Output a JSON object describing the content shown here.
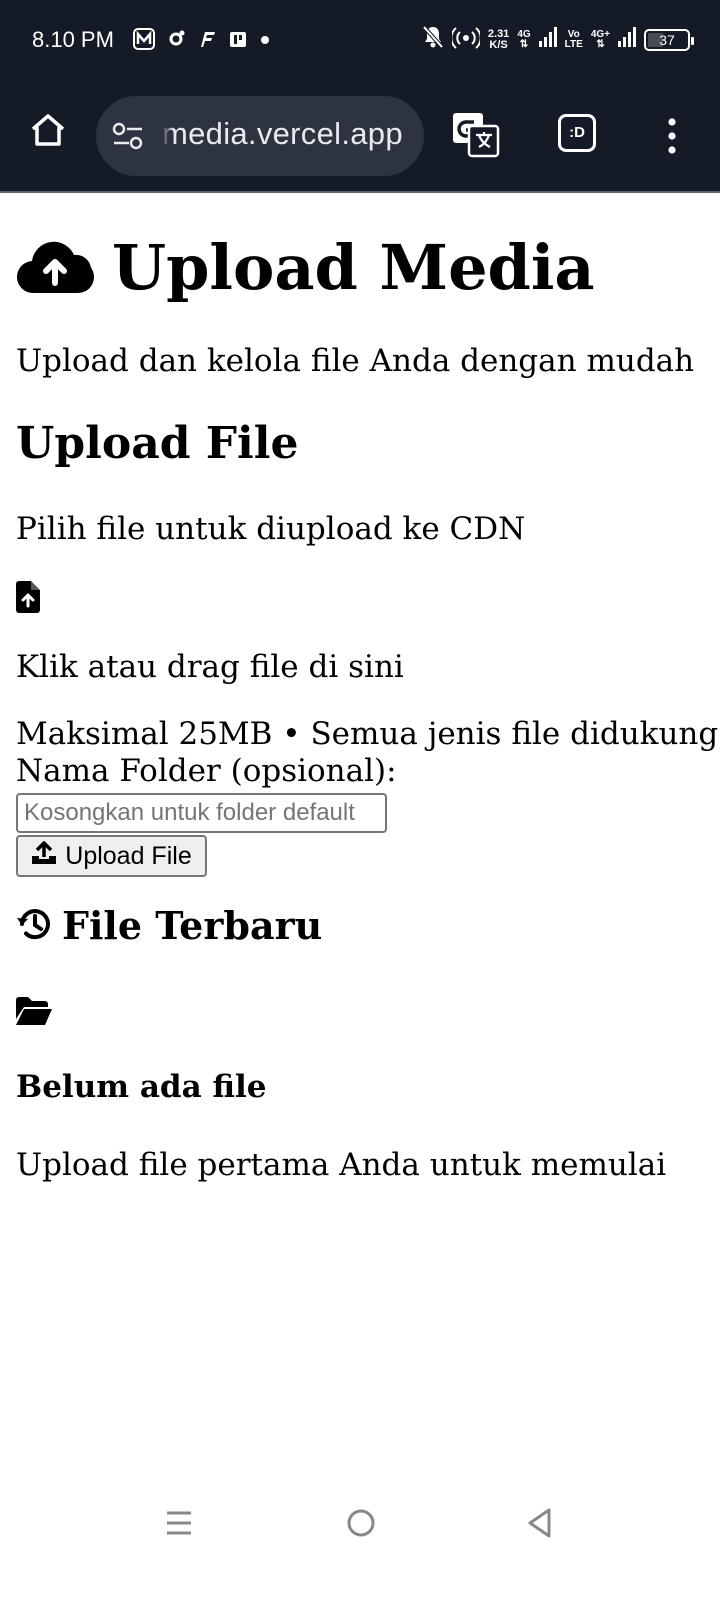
{
  "status_bar": {
    "time": "8.10 PM",
    "speed_value": "2.31",
    "speed_unit": "K/S",
    "net1": "4G",
    "net2_top": "Vo",
    "net2_bottom": "LTE",
    "net3": "4G+",
    "battery": "37"
  },
  "browser": {
    "url": "media.vercel.app",
    "tab_label": ":D"
  },
  "page": {
    "title": "Upload Media",
    "subtitle": "Upload dan kelola file Anda dengan mudah",
    "upload_section": {
      "heading": "Upload File",
      "description": "Pilih file untuk diupload ke CDN",
      "drop_text": "Klik atau drag file di sini",
      "limit_text": "Maksimal 25MB • Semua jenis file didukung",
      "folder_label": "Nama Folder (opsional):",
      "folder_placeholder": "Kosongkan untuk folder default",
      "upload_button": "Upload File"
    },
    "recent_section": {
      "heading": "File Terbaru",
      "empty_title": "Belum ada file",
      "empty_desc": "Upload file pertama Anda untuk memulai"
    }
  },
  "icons": {
    "title_icon": "cloud-upload-icon",
    "file_icon": "file-upload-icon",
    "history_icon": "history-icon",
    "empty_icon": "folder-open-icon"
  }
}
